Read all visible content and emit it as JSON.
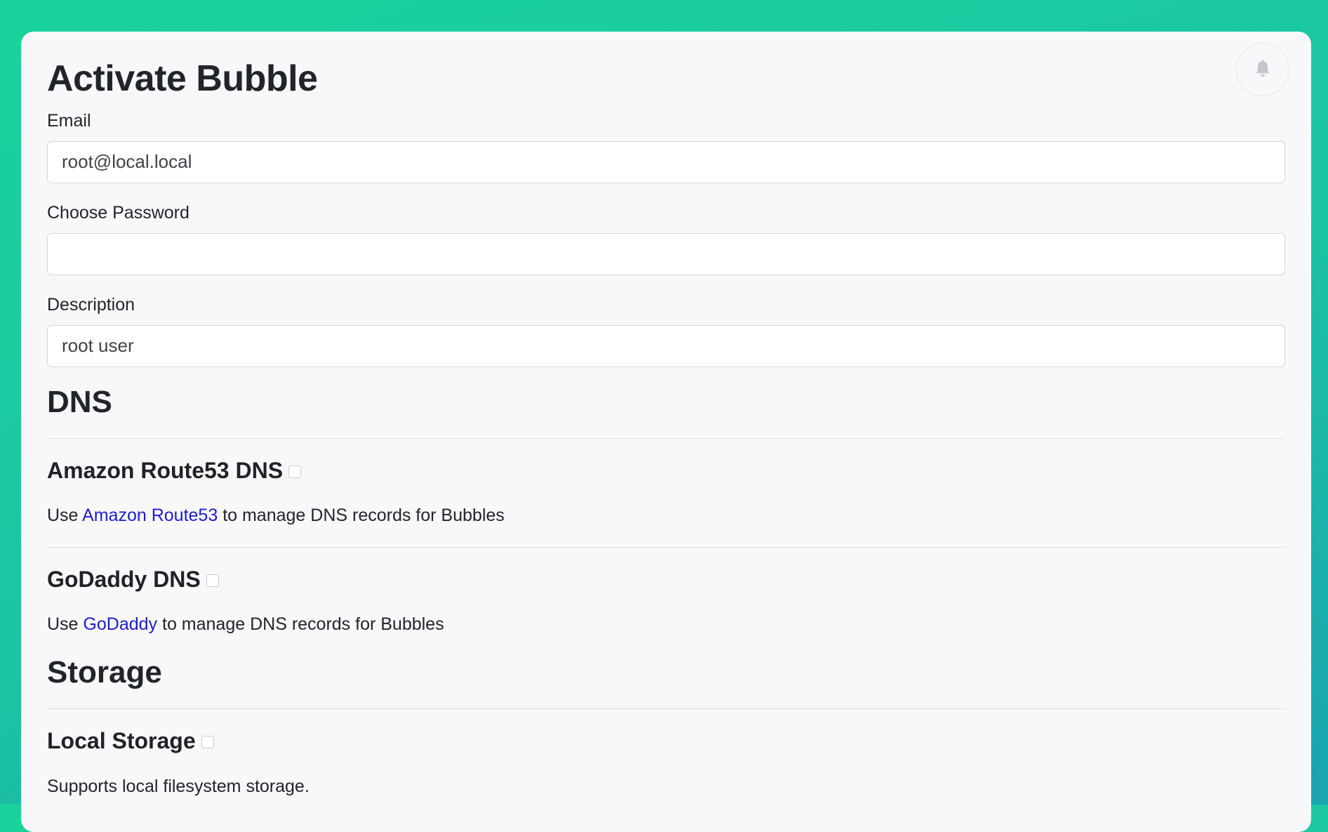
{
  "page": {
    "title": "Activate Bubble"
  },
  "form": {
    "email_label": "Email",
    "email_value": "root@local.local",
    "password_label": "Choose Password",
    "password_value": "",
    "description_label": "Description",
    "description_value": "root user"
  },
  "dns": {
    "heading": "DNS",
    "items": [
      {
        "title": "Amazon Route53 DNS",
        "desc_prefix": "Use",
        "link_text": "Amazon Route53",
        "desc_suffix": "to manage DNS records for Bubbles",
        "checked": false
      },
      {
        "title": "GoDaddy DNS",
        "desc_prefix": "Use",
        "link_text": "GoDaddy",
        "desc_suffix": "to manage DNS records for Bubbles",
        "checked": false
      }
    ]
  },
  "storage": {
    "heading": "Storage",
    "items": [
      {
        "title": "Local Storage",
        "desc": "Supports local filesystem storage.",
        "checked": false
      }
    ]
  },
  "icons": {
    "notification": "bell-icon"
  },
  "colors": {
    "background_top": "#1ad39c",
    "background_bottom": "#1aa3b1",
    "card": "#f8f8fa",
    "link": "#1d1dcc",
    "text": "#212529"
  }
}
